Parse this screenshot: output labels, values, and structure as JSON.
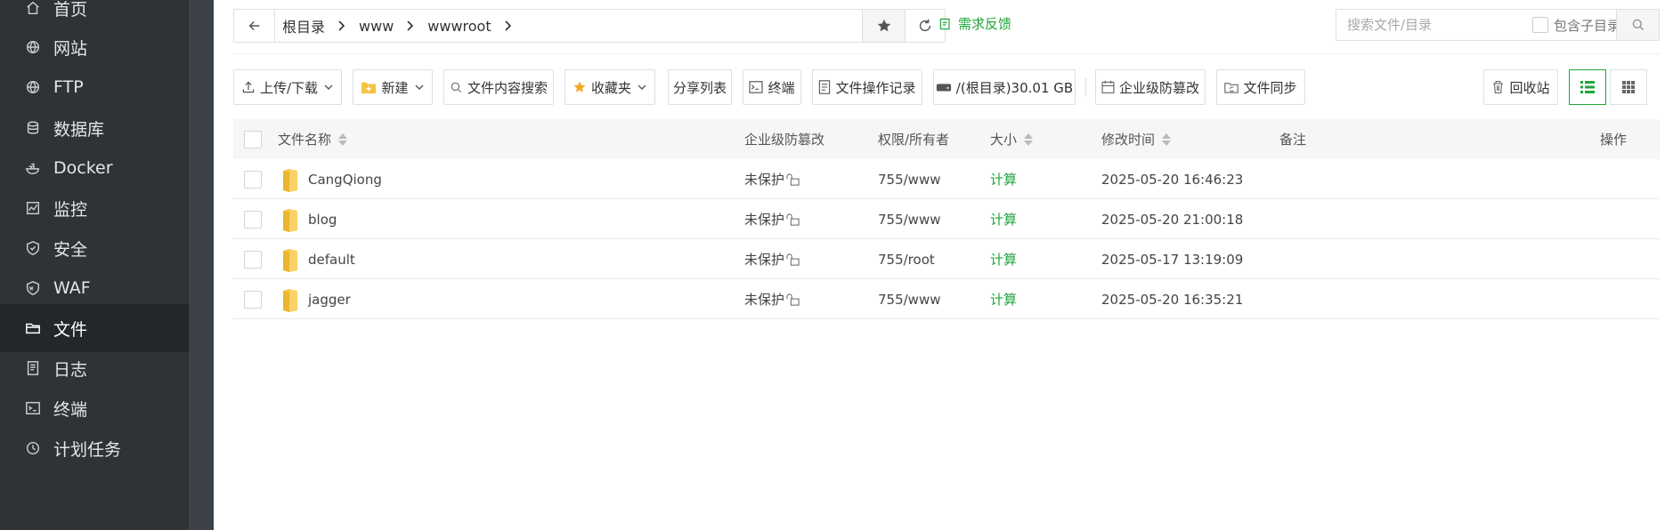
{
  "sidebar": {
    "items": [
      {
        "label": "首页",
        "icon": "home-icon"
      },
      {
        "label": "网站",
        "icon": "globe-icon"
      },
      {
        "label": "FTP",
        "icon": "globe-icon"
      },
      {
        "label": "数据库",
        "icon": "database-icon"
      },
      {
        "label": "Docker",
        "icon": "docker-icon"
      },
      {
        "label": "监控",
        "icon": "monitor-icon"
      },
      {
        "label": "安全",
        "icon": "shield-icon"
      },
      {
        "label": "WAF",
        "icon": "waf-shield-icon"
      },
      {
        "label": "文件",
        "icon": "folder-icon"
      },
      {
        "label": "日志",
        "icon": "log-icon"
      },
      {
        "label": "终端",
        "icon": "terminal-icon"
      },
      {
        "label": "计划任务",
        "icon": "clock-icon"
      }
    ],
    "active": "文件"
  },
  "pathbar": {
    "crumbs": [
      "根目录",
      "www",
      "wwwroot"
    ]
  },
  "feedback_label": "需求反馈",
  "search": {
    "placeholder": "搜索文件/目录",
    "include_sub_label": "包含子目录"
  },
  "toolbar": {
    "upload_label": "上传/下载",
    "new_label": "新建",
    "content_search_label": "文件内容搜索",
    "favorites_label": "收藏夹",
    "share_list_label": "分享列表",
    "terminal_label": "终端",
    "file_ops_log_label": "文件操作记录",
    "disk_label": "/(根目录)30.01 GB",
    "tamper_label": "企业级防篡改",
    "file_sync_label": "文件同步",
    "recycle_label": "回收站"
  },
  "table": {
    "headers": {
      "name": "文件名称",
      "tamper": "企业级防篡改",
      "perm": "权限/所有者",
      "size": "大小",
      "mtime": "修改时间",
      "note": "备注",
      "ops": "操作"
    },
    "rows": [
      {
        "name": "CangQiong",
        "tamper": "未保护",
        "perm": "755/www",
        "size": "计算",
        "mtime": "2025-05-20 16:46:23"
      },
      {
        "name": "blog",
        "tamper": "未保护",
        "perm": "755/www",
        "size": "计算",
        "mtime": "2025-05-20 21:00:18"
      },
      {
        "name": "default",
        "tamper": "未保护",
        "perm": "755/root",
        "size": "计算",
        "mtime": "2025-05-17 13:19:09"
      },
      {
        "name": "jagger",
        "tamper": "未保护",
        "perm": "755/www",
        "size": "计算",
        "mtime": "2025-05-20 16:35:21"
      }
    ]
  },
  "colors": {
    "sidebar_bg": "#2f3338",
    "sidebar_active": "#23262a",
    "accent_green": "#20a53a",
    "folder_yellow": "#f5c242"
  }
}
